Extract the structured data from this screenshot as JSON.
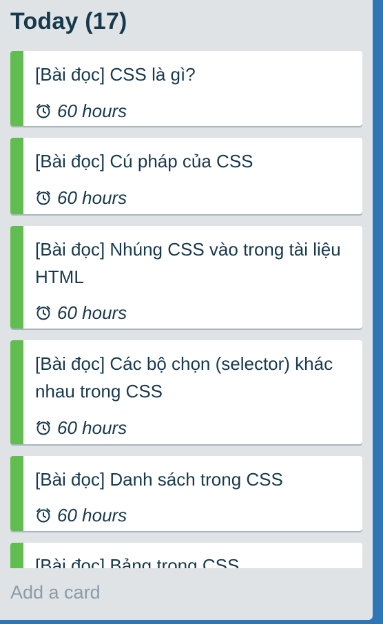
{
  "list": {
    "title": "Today (17)",
    "add_card_label": "Add a card"
  },
  "cards": [
    {
      "title": "[Bài đọc] CSS là gì?",
      "badge_icon": "alarm-clock-icon",
      "badge_text": "60 hours",
      "label_color": "#61bd4f"
    },
    {
      "title": "[Bài đọc] Cú pháp của CSS",
      "badge_icon": "alarm-clock-icon",
      "badge_text": "60 hours",
      "label_color": "#61bd4f"
    },
    {
      "title": "[Bài đọc] Nhúng CSS vào trong tài liệu HTML",
      "badge_icon": "alarm-clock-icon",
      "badge_text": "60 hours",
      "label_color": "#61bd4f"
    },
    {
      "title": "[Bài đọc] Các bộ chọn (selector) khác nhau trong CSS",
      "badge_icon": "alarm-clock-icon",
      "badge_text": "60 hours",
      "label_color": "#61bd4f"
    },
    {
      "title": "[Bài đọc] Danh sách trong CSS",
      "badge_icon": "alarm-clock-icon",
      "badge_text": "60 hours",
      "label_color": "#61bd4f"
    },
    {
      "title": "[Bài đọc] Bảng trong CSS",
      "label_color": "#61bd4f"
    }
  ],
  "colors": {
    "list_background": "#dfe3e6",
    "board_background": "#2e77b6",
    "label_green": "#61bd4f",
    "text_dark": "#17394d",
    "add_card_text": "#8a9ba8"
  }
}
